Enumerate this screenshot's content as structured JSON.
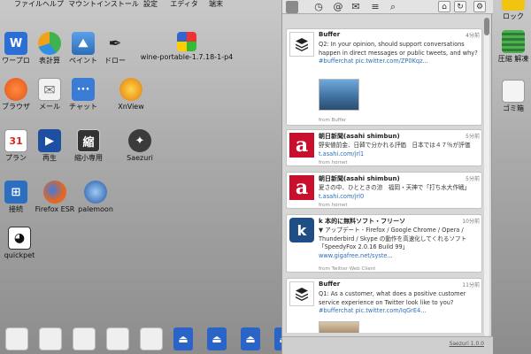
{
  "desktop": {
    "top_row": [
      "ファイル",
      "ヘルプ",
      "マウントインストール",
      "設定",
      "エディタ",
      "端末"
    ],
    "row2": [
      "ワープロ",
      "表計算",
      "ペイント",
      "ドロー",
      "wine-portable-1.7.18-1-p4"
    ],
    "row3": [
      "ブラウザ",
      "メール",
      "チャット",
      "XnView"
    ],
    "row4": [
      "プラン",
      "再生",
      "縮小専用",
      "Saezuri"
    ],
    "row5": [
      "接続",
      "Firefox ESR",
      "palemoon"
    ],
    "row6": [
      "quickpet"
    ],
    "right_icons": [
      "ロック",
      "圧縮 解凍",
      "ゴミ箱"
    ],
    "shrink_glyph": "縮"
  },
  "saezuri": {
    "footer": "Saezuri 1.0.0",
    "tweets": [
      {
        "name": "Buffer",
        "time": "4分前",
        "text": "Q2: In your opinion, should support conversations happen in direct messages or public tweets, and why? #bufferchat pic.twitter.com/ZP0Kqz...",
        "source": "from Buffer"
      },
      {
        "name": "朝日新聞(asahi shimbun)",
        "time": "5分前",
        "text": "野安値前金、日韓で分かれる評価　日本では４７％が評価 t.asahi.com/jrl1",
        "source": "from hornet"
      },
      {
        "name": "朝日新聞(asahi shimbun)",
        "time": "5分前",
        "text": "夏さの中、ひとときの涼　福岡・天神で「打ち水大作戦」 t.asahi.com/jrl0",
        "source": "from hornet"
      },
      {
        "name": "k 本的に無料ソフト・フリーソ",
        "time": "10分前",
        "text": "▼ アップデート - Firefox / Google Chrome / Opera / Thunderbird / Skype の動作を高速化してくれるソフト「SpeedyFox 2.0.16 Build 99」 www.gigafree.net/syste...",
        "source": "from Twitter Web Client"
      },
      {
        "name": "Buffer",
        "time": "11分前",
        "text": "Q1: As a customer, what does a positive customer service experience on Twitter look like to you? #bufferchat pic.twitter.com/IqGrE4...",
        "source": ""
      }
    ]
  },
  "colors": {
    "usb_blue": "#2a64c7",
    "asahi_red": "#c8102e",
    "link": "#2a6ebb"
  }
}
